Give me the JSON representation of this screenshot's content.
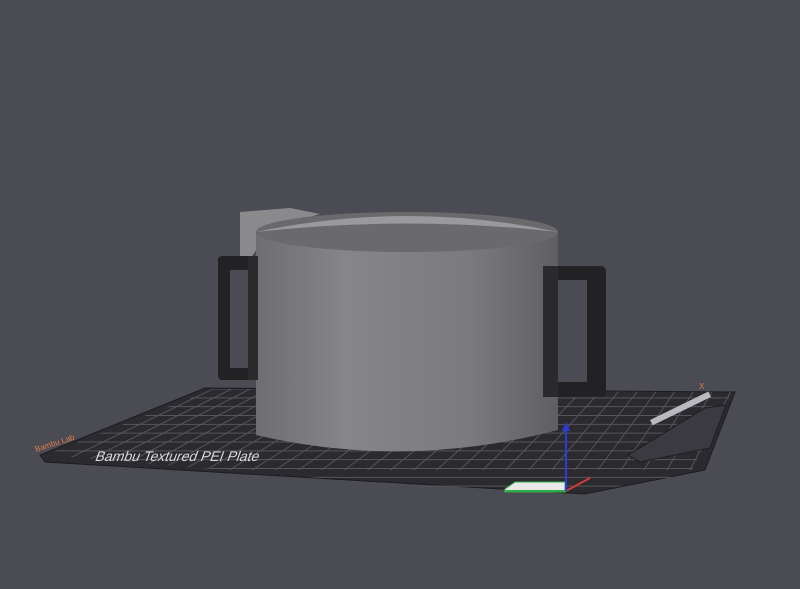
{
  "app": {
    "view": "3d-prepare-viewport"
  },
  "colors": {
    "background": "#4b4b53",
    "plate": "#2a2a2f",
    "grid": "#5a5a62",
    "model": "#7b7b7d",
    "model_rim": "#8e8e90",
    "model_inner": "#6a6a6c",
    "handle": "#222225",
    "axis_x": "#d33a3a",
    "axis_y": "#2eae4a",
    "axis_z": "#2c3bd6",
    "plate_label_text": "#d9d9d9",
    "corner_label_text": "#e07b4a"
  },
  "plate": {
    "name": "Bambu Textured PEI Plate",
    "corner_label_left": "Bambu Lab",
    "corner_label_right": "X"
  },
  "model": {
    "type": "cylindrical-pot-with-two-handles"
  }
}
